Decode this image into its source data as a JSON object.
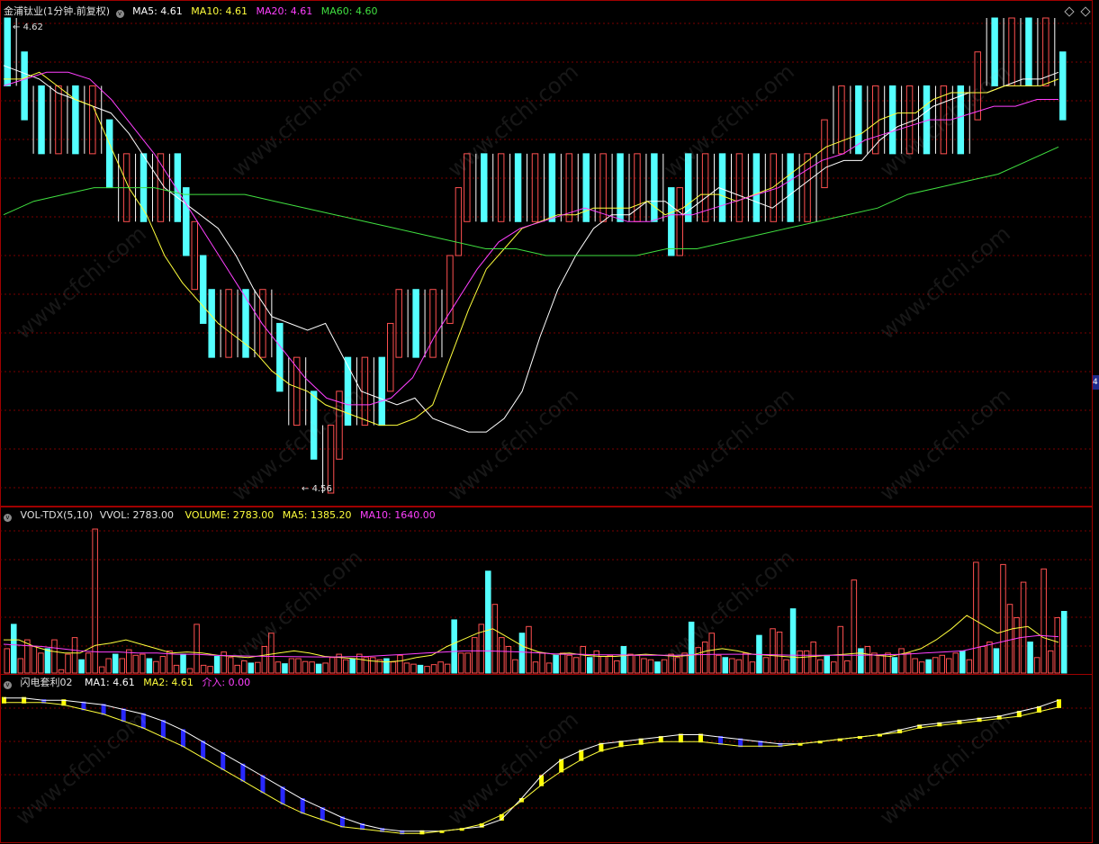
{
  "price_panel": {
    "stock": "金浦钛业(1分钟.前复权)",
    "ma5": "MA5: 4.61",
    "ma10": "MA10: 4.61",
    "ma20": "MA20: 4.61",
    "ma60": "MA60: 4.60",
    "high_label": "4.62",
    "low_label": "4.56"
  },
  "volume_panel": {
    "name": "VOL-TDX(5,10)",
    "vvol": "VVOL: 2783.00",
    "volume": "VOLUME: 2783.00",
    "ma5": "MA5: 1385.20",
    "ma10": "MA10: 1640.00"
  },
  "indicator_panel": {
    "name": "闪电套利02",
    "ma1": "MA1: 4.61",
    "ma2": "MA2: 4.61",
    "entry": "介入: 0.00"
  },
  "colors": {
    "up": "#ff5050",
    "down": "#54ffff",
    "flat": "#ffffff",
    "ma5": "#ffffff",
    "ma10": "#ffff3c",
    "ma20": "#ff40ff",
    "ma60": "#40e040",
    "grid": "#7a0000",
    "ind_up": "#ffff00",
    "ind_down": "#2828ff"
  },
  "chart_data": [
    {
      "type": "candlestick",
      "title": "金浦钛业(1分钟.前复权)",
      "ylim": [
        4.555,
        4.625
      ],
      "annotations": [
        "4.62",
        "4.56"
      ],
      "price_steps": [
        4.62,
        4.62,
        4.61,
        4.61,
        4.61,
        4.61,
        4.61,
        4.61,
        4.61,
        4.61,
        4.61,
        4.61,
        4.6,
        4.6,
        4.6,
        4.6,
        4.6,
        4.6,
        4.6,
        4.6,
        4.6,
        4.59,
        4.59,
        4.58,
        4.58,
        4.58,
        4.58,
        4.58,
        4.58,
        4.58,
        4.58,
        4.58,
        4.57,
        4.57,
        4.57,
        4.57,
        4.56,
        4.56,
        4.56,
        4.57,
        4.57,
        4.57,
        4.57,
        4.57,
        4.57,
        4.58,
        4.58,
        4.58,
        4.58,
        4.58,
        4.58,
        4.58,
        4.59,
        4.6,
        4.6,
        4.6,
        4.6,
        4.6,
        4.6,
        4.6,
        4.6,
        4.6,
        4.6,
        4.6,
        4.6,
        4.6,
        4.6,
        4.6,
        4.6,
        4.6,
        4.6,
        4.6,
        4.6,
        4.6,
        4.6,
        4.6,
        4.6,
        4.6,
        4.59,
        4.6,
        4.6,
        4.6,
        4.6,
        4.6,
        4.6,
        4.6,
        4.6,
        4.6,
        4.6,
        4.6,
        4.6,
        4.6,
        4.6,
        4.6,
        4.6,
        4.6,
        4.61,
        4.61,
        4.61,
        4.61,
        4.61,
        4.61,
        4.61,
        4.61,
        4.61,
        4.61,
        4.61,
        4.61,
        4.61,
        4.61,
        4.61,
        4.61,
        4.61,
        4.61,
        4.62,
        4.62,
        4.62,
        4.62,
        4.62,
        4.62,
        4.62,
        4.62,
        4.62,
        4.62,
        4.61
      ],
      "series": [
        {
          "name": "MA5",
          "values": [
            4.618,
            4.617,
            4.616,
            4.614,
            4.613,
            4.612,
            4.611,
            4.608,
            4.604,
            4.6,
            4.598,
            4.596,
            4.594,
            4.59,
            4.585,
            4.581,
            4.58,
            4.579,
            4.58,
            4.575,
            4.57,
            4.569,
            4.568,
            4.569,
            4.566,
            4.565,
            4.564,
            4.564,
            4.566,
            4.57,
            4.578,
            4.585,
            4.59,
            4.594,
            4.596,
            4.596,
            4.598,
            4.598,
            4.596,
            4.598,
            4.6,
            4.599,
            4.598,
            4.597,
            4.599,
            4.601,
            4.603,
            4.604,
            4.604,
            4.607,
            4.609,
            4.61,
            4.612,
            4.613,
            4.614,
            4.614,
            4.615,
            4.616,
            4.616,
            4.617
          ]
        },
        {
          "name": "MA10",
          "values": [
            4.616,
            4.616,
            4.617,
            4.615,
            4.613,
            4.612,
            4.606,
            4.6,
            4.596,
            4.59,
            4.586,
            4.583,
            4.58,
            4.578,
            4.576,
            4.573,
            4.571,
            4.57,
            4.568,
            4.567,
            4.566,
            4.565,
            4.565,
            4.566,
            4.568,
            4.575,
            4.582,
            4.588,
            4.591,
            4.594,
            4.595,
            4.596,
            4.596,
            4.597,
            4.597,
            4.597,
            4.598,
            4.596,
            4.597,
            4.599,
            4.599,
            4.598,
            4.599,
            4.6,
            4.602,
            4.604,
            4.606,
            4.607,
            4.608,
            4.61,
            4.611,
            4.611,
            4.613,
            4.614,
            4.614,
            4.614,
            4.615,
            4.615,
            4.615,
            4.616
          ]
        },
        {
          "name": "MA20",
          "values": [
            4.615,
            4.616,
            4.617,
            4.617,
            4.616,
            4.613,
            4.609,
            4.605,
            4.6,
            4.595,
            4.59,
            4.585,
            4.58,
            4.576,
            4.572,
            4.569,
            4.568,
            4.568,
            4.569,
            4.572,
            4.578,
            4.583,
            4.588,
            4.592,
            4.594,
            4.595,
            4.596,
            4.597,
            4.596,
            4.595,
            4.595,
            4.596,
            4.596,
            4.597,
            4.598,
            4.599,
            4.6,
            4.602,
            4.604,
            4.605,
            4.607,
            4.608,
            4.609,
            4.61,
            4.61,
            4.611,
            4.612,
            4.612,
            4.613,
            4.613
          ]
        },
        {
          "name": "MA60",
          "values": [
            4.596,
            4.598,
            4.599,
            4.6,
            4.6,
            4.6,
            4.599,
            4.599,
            4.599,
            4.598,
            4.597,
            4.596,
            4.595,
            4.594,
            4.593,
            4.592,
            4.591,
            4.591,
            4.59,
            4.59,
            4.59,
            4.59,
            4.591,
            4.591,
            4.592,
            4.593,
            4.594,
            4.595,
            4.596,
            4.597,
            4.599,
            4.6,
            4.601,
            4.602,
            4.604,
            4.606
          ]
        }
      ]
    },
    {
      "type": "bar",
      "title": "VOL-TDX(5,10)",
      "values": [
        1100,
        2200,
        650,
        1500,
        1200,
        900,
        1100,
        1500,
        150,
        850,
        1600,
        600,
        900,
        6500,
        280,
        650,
        850,
        650,
        1050,
        800,
        850,
        650,
        520,
        750,
        1000,
        350,
        850,
        200,
        2200,
        350,
        300,
        750,
        950,
        700,
        350,
        550,
        450,
        480,
        1200,
        1800,
        500,
        420,
        650,
        650,
        520,
        500,
        400,
        450,
        700,
        850,
        600,
        650,
        850,
        700,
        700,
        600,
        650,
        500,
        800,
        450,
        400,
        350,
        300,
        380,
        500,
        400,
        2400,
        900,
        900,
        1600,
        2200,
        4600,
        3100,
        1600,
        1200,
        600,
        1800,
        2100,
        500,
        900,
        450,
        800,
        900,
        800,
        700,
        1200,
        700,
        1000,
        750,
        800,
        550,
        1200,
        850,
        800,
        650,
        600,
        500,
        600,
        850,
        700,
        900,
        2300,
        1150,
        1400,
        1800,
        800,
        700,
        650,
        600,
        900,
        500,
        1700,
        700,
        2000,
        1850,
        600,
        2900,
        1000,
        1000,
        1400,
        600,
        800,
        500,
        2100,
        550,
        4200,
        1100,
        1200,
        900,
        800,
        900,
        700,
        1100,
        900,
        650,
        500,
        600,
        700,
        800,
        650,
        900,
        1000,
        600,
        5000,
        1200,
        1400,
        1100,
        4900,
        3100,
        2500,
        4100,
        1400,
        700,
        4700,
        1000,
        2500,
        2783
      ],
      "series": [
        {
          "name": "MA5",
          "values": [
            1500,
            1500,
            1200,
            1000,
            900,
            900,
            1250,
            1350,
            1500,
            1300,
            1100,
            900,
            950,
            900,
            800,
            750,
            700,
            800,
            900,
            1000,
            900,
            750,
            700,
            650,
            550,
            500,
            550,
            700,
            800,
            1200,
            1500,
            1800,
            2000,
            1600,
            1200,
            950,
            850,
            900,
            800,
            750,
            750,
            800,
            850,
            800,
            750,
            800,
            1000,
            1100,
            1000,
            850,
            800,
            750,
            700,
            750,
            800,
            850,
            900,
            800,
            750,
            900,
            1100,
            1500,
            2000,
            2600,
            2200,
            1800,
            2000,
            2100,
            1600,
            1385
          ]
        },
        {
          "name": "MA10",
          "values": [
            1300,
            1250,
            1200,
            1100,
            1000,
            950,
            950,
            900,
            900,
            850,
            850,
            800,
            780,
            760,
            750,
            740,
            730,
            720,
            740,
            750,
            800,
            850,
            900,
            950,
            1000,
            1000,
            980,
            950,
            900,
            850,
            850,
            820,
            820,
            800,
            800,
            800,
            820,
            840,
            850,
            850,
            830,
            810,
            800,
            800,
            800,
            810,
            830,
            850,
            900,
            950,
            1000,
            1200,
            1400,
            1600,
            1700,
            1640
          ]
        }
      ]
    },
    {
      "type": "line",
      "title": "闪电套利02",
      "series": [
        {
          "name": "MA1",
          "values": [
            4.619,
            4.619,
            4.618,
            4.618,
            4.617,
            4.616,
            4.614,
            4.612,
            4.609,
            4.605,
            4.6,
            4.595,
            4.59,
            4.585,
            4.58,
            4.575,
            4.571,
            4.567,
            4.564,
            4.562,
            4.561,
            4.561,
            4.561,
            4.562,
            4.563,
            4.566,
            4.575,
            4.585,
            4.592,
            4.596,
            4.599,
            4.6,
            4.601,
            4.602,
            4.603,
            4.603,
            4.602,
            4.601,
            4.6,
            4.599,
            4.599,
            4.6,
            4.601,
            4.602,
            4.603,
            4.605,
            4.607,
            4.608,
            4.609,
            4.61,
            4.611,
            4.613,
            4.615,
            4.618
          ]
        },
        {
          "name": "MA2",
          "values": [
            4.617,
            4.617,
            4.617,
            4.616,
            4.614,
            4.612,
            4.609,
            4.606,
            4.602,
            4.598,
            4.593,
            4.588,
            4.583,
            4.578,
            4.573,
            4.569,
            4.566,
            4.563,
            4.562,
            4.561,
            4.56,
            4.56,
            4.561,
            4.562,
            4.564,
            4.568,
            4.574,
            4.581,
            4.587,
            4.592,
            4.596,
            4.598,
            4.599,
            4.6,
            4.6,
            4.6,
            4.599,
            4.598,
            4.598,
            4.598,
            4.599,
            4.6,
            4.601,
            4.602,
            4.603,
            4.604,
            4.606,
            4.607,
            4.608,
            4.609,
            4.61,
            4.611,
            4.613,
            4.615
          ]
        }
      ]
    }
  ]
}
